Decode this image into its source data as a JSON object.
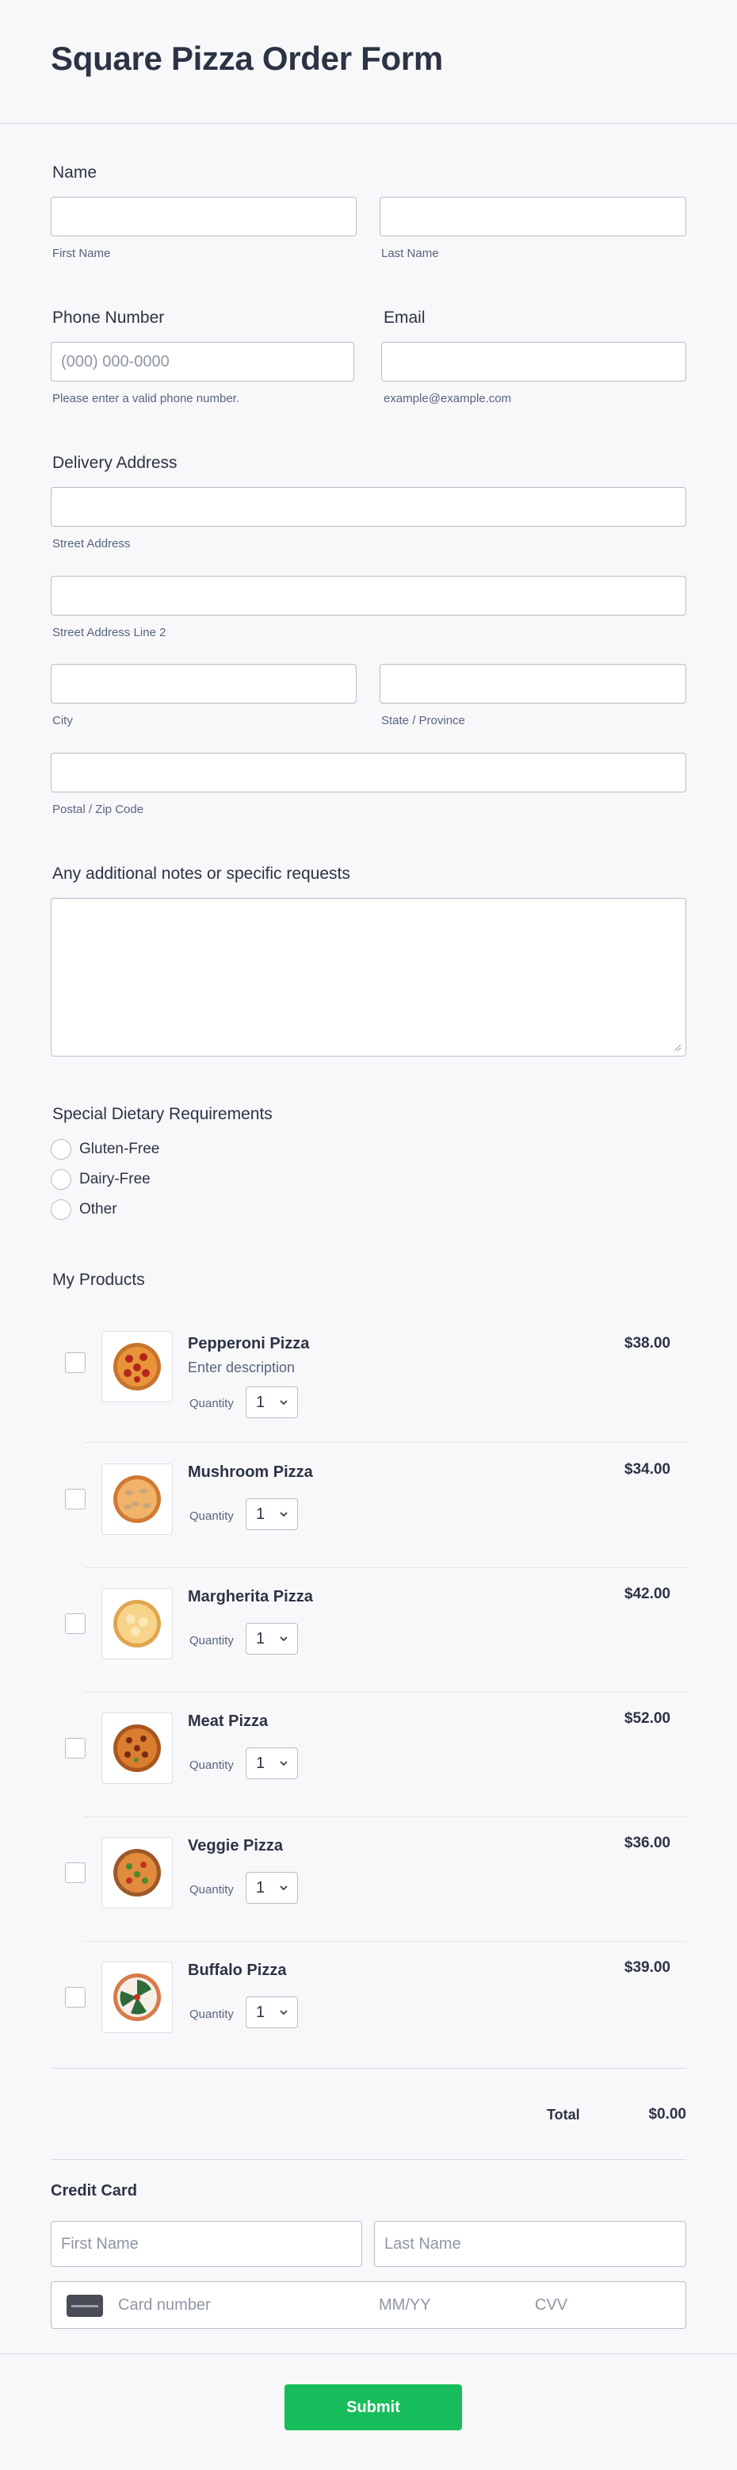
{
  "form": {
    "title": "Square Pizza Order Form",
    "submit_label": "Submit"
  },
  "name": {
    "label": "Name",
    "first_sub": "First Name",
    "last_sub": "Last Name",
    "first_value": "",
    "last_value": ""
  },
  "phone": {
    "label": "Phone Number",
    "placeholder": "(000) 000-0000",
    "sub": "Please enter a valid phone number.",
    "value": ""
  },
  "email": {
    "label": "Email",
    "sub": "example@example.com",
    "value": ""
  },
  "address": {
    "label": "Delivery Address",
    "street_sub": "Street Address",
    "street2_sub": "Street Address Line 2",
    "city_sub": "City",
    "state_sub": "State / Province",
    "zip_sub": "Postal / Zip Code"
  },
  "notes": {
    "label": "Any additional notes or specific requests",
    "value": ""
  },
  "dietary": {
    "label": "Special Dietary Requirements",
    "options": [
      "Gluten-Free",
      "Dairy-Free",
      "Other"
    ]
  },
  "products": {
    "label": "My Products",
    "qty_label": "Quantity",
    "items": [
      {
        "name": "Pepperoni Pizza",
        "description": "Enter description",
        "price": "$38.00",
        "qty": "1",
        "icon": "pepperoni-pizza-icon"
      },
      {
        "name": "Mushroom Pizza",
        "description": "",
        "price": "$34.00",
        "qty": "1",
        "icon": "mushroom-pizza-icon"
      },
      {
        "name": "Margherita Pizza",
        "description": "",
        "price": "$42.00",
        "qty": "1",
        "icon": "margherita-pizza-icon"
      },
      {
        "name": "Meat Pizza",
        "description": "",
        "price": "$52.00",
        "qty": "1",
        "icon": "meat-pizza-icon"
      },
      {
        "name": "Veggie Pizza",
        "description": "",
        "price": "$36.00",
        "qty": "1",
        "icon": "veggie-pizza-icon"
      },
      {
        "name": "Buffalo Pizza",
        "description": "",
        "price": "$39.00",
        "qty": "1",
        "icon": "buffalo-pizza-icon"
      }
    ],
    "total_label": "Total",
    "total_value": "$0.00"
  },
  "credit_card": {
    "label": "Credit Card",
    "first_placeholder": "First Name",
    "last_placeholder": "Last Name",
    "number_placeholder": "Card number",
    "expiry_placeholder": "MM/YY",
    "cvv_placeholder": "CVV"
  },
  "colors": {
    "submit_green": "#18bd5b",
    "text_dark": "#2c3345",
    "text_muted": "#57647e",
    "border": "#b8bdc9",
    "background": "#f8f8fa"
  }
}
